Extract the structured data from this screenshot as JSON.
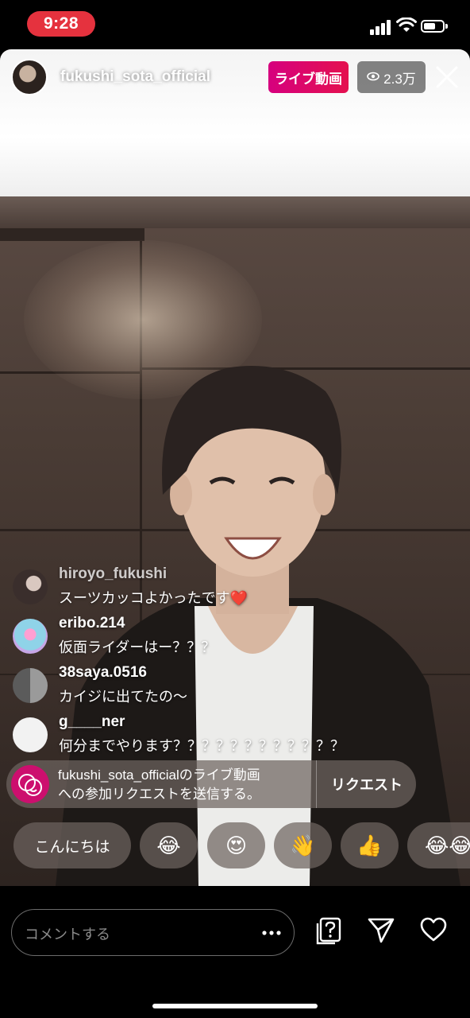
{
  "status_bar": {
    "time": "9:28"
  },
  "header": {
    "username": "fukushi_sota_official",
    "live_label": "ライブ動画",
    "viewer_count": "2.3万",
    "icons": [
      "eye-icon",
      "close-icon"
    ]
  },
  "comments": [
    {
      "user": "hiroyo_fukushi",
      "text": "スーツカッコよかったです",
      "emoji": "❤️"
    },
    {
      "user": "eribo.214",
      "text": "仮面ライダーはー？？？"
    },
    {
      "user": "38saya.0516",
      "text": "カイジに出てたの〜"
    },
    {
      "user": "g____ner",
      "text": "何分までやります？？？？？？？？？？？？"
    }
  ],
  "request": {
    "text_line1": "fukushi_sota_officialのライブ動画",
    "text_line2": "への参加リクエストを送信する。",
    "button": "リクエスト"
  },
  "quick_reactions": [
    "こんにちは",
    "😂",
    "😍",
    "👋",
    "👍",
    "😂😂"
  ],
  "bottom_bar": {
    "comment_placeholder": "コメントする",
    "icons": [
      "more-icon",
      "question-icon",
      "send-icon",
      "heart-icon"
    ]
  },
  "colors": {
    "live_badge": "#d6007e",
    "time_pill": "#e5323e",
    "request_icon": "#cc0f6e"
  }
}
